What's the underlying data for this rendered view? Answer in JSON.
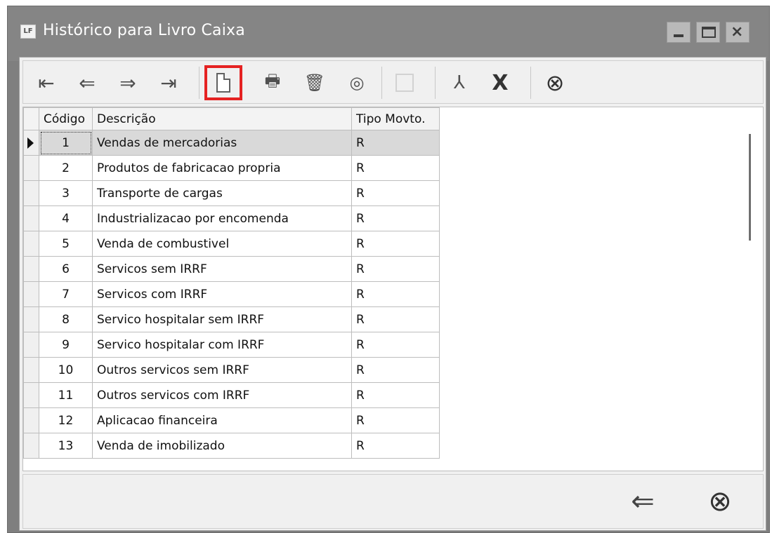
{
  "window": {
    "app_icon_label": "LF",
    "title": "Histórico para Livro Caixa"
  },
  "toolbar": {
    "first": "⇤",
    "prev": "⇐",
    "next": "⇒",
    "last": "⇥",
    "print": "🖶",
    "delete": "🗑",
    "view": "◎",
    "pdf": "⅄",
    "excel": "X",
    "close": "⊗"
  },
  "grid": {
    "headers": {
      "code": "Código",
      "description": "Descrição",
      "type": "Tipo Movto."
    },
    "rows": [
      {
        "code": "1",
        "description": "Vendas de mercadorias",
        "type": "R"
      },
      {
        "code": "2",
        "description": "Produtos de fabricacao propria",
        "type": "R"
      },
      {
        "code": "3",
        "description": "Transporte de cargas",
        "type": "R"
      },
      {
        "code": "4",
        "description": "Industrializacao por encomenda",
        "type": "R"
      },
      {
        "code": "5",
        "description": "Venda de combustivel",
        "type": "R"
      },
      {
        "code": "6",
        "description": "Servicos sem IRRF",
        "type": "R"
      },
      {
        "code": "7",
        "description": "Servicos com IRRF",
        "type": "R"
      },
      {
        "code": "8",
        "description": "Servico hospitalar sem IRRF",
        "type": "R"
      },
      {
        "code": "9",
        "description": "Servico hospitalar com IRRF",
        "type": "R"
      },
      {
        "code": "10",
        "description": "Outros servicos sem IRRF",
        "type": "R"
      },
      {
        "code": "11",
        "description": "Outros servicos com IRRF",
        "type": "R"
      },
      {
        "code": "12",
        "description": "Aplicacao financeira",
        "type": "R"
      },
      {
        "code": "13",
        "description": "Venda de imobilizado",
        "type": "R"
      }
    ]
  },
  "footer": {
    "back": "⇐",
    "close": "⊗"
  },
  "colors": {
    "highlight": "#e52222",
    "selected_row": "#d9d9d9",
    "titlebar": "#858585"
  }
}
